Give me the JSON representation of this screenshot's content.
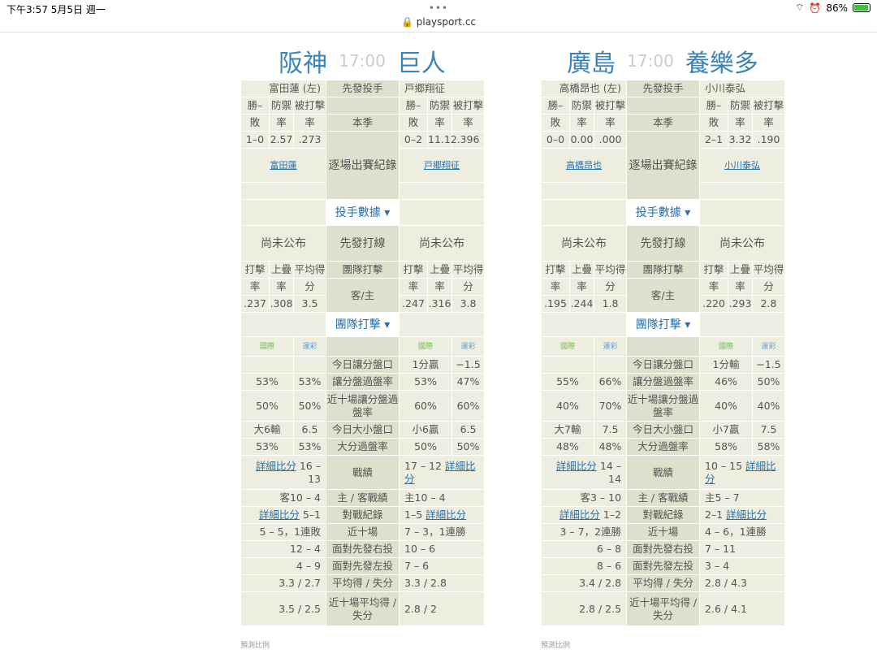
{
  "status": {
    "time": "下午3:57   5月5日 週一",
    "battery": "86%"
  },
  "url": "playsport.cc",
  "games": [
    {
      "away": "阪神",
      "time": "17:00",
      "home": "巨人",
      "pitching": {
        "away_pitcher": "富田蓮 (左)",
        "label": "先發投手",
        "home_pitcher": "戸郷翔征",
        "h1": [
          "勝–",
          "防禦",
          "被打擊"
        ],
        "h2": [
          "敗",
          "率",
          "率"
        ],
        "season_label": "本季",
        "away_stats": [
          "1–0",
          "2.57",
          ".273"
        ],
        "home_stats": [
          "0–2",
          "11.12",
          ".396"
        ],
        "log_label": "逐場出賽紀錄",
        "away_link": "富田蓮",
        "home_link": "戸郷翔征",
        "dropdown": "投手數據 ▾"
      },
      "batting": {
        "away_lineup": "尚未公布",
        "label": "先發打線",
        "home_lineup": "尚未公布",
        "h1": [
          "打擊",
          "上疊",
          "平均得"
        ],
        "h2": [
          "率",
          "率",
          "分"
        ],
        "team_label": "團隊打擊",
        "ha_label": "客/主",
        "away_stats": [
          ".237",
          ".308",
          "3.5"
        ],
        "home_stats": [
          ".247",
          ".316",
          "3.8"
        ],
        "dropdown": "團隊打擊 ▾"
      },
      "odds": {
        "src_a": "國際",
        "src_b": "運彩",
        "labels": [
          "今日讓分盤口",
          "讓分盤過盤率",
          "近十場讓分盤過盤率",
          "今日大小盤口",
          "大分過盤率"
        ],
        "away_rows": [
          [
            "",
            ""
          ],
          [
            "53%",
            "53%"
          ],
          [
            "50%",
            "50%"
          ],
          [
            "大6輸",
            "6.5"
          ],
          [
            "53%",
            "53%"
          ]
        ],
        "home_rows": [
          [
            "1分贏",
            "−1.5"
          ],
          [
            "53%",
            "47%"
          ],
          [
            "60%",
            "60%"
          ],
          [
            "小6贏",
            "6.5"
          ],
          [
            "50%",
            "50%"
          ]
        ]
      },
      "record": {
        "detail": "詳細比分",
        "rows": [
          {
            "label": "戰績",
            "away": "16 – 13",
            "home": "17 – 12",
            "link": true
          },
          {
            "label": "主 / 客戰績",
            "away": "客10 – 4",
            "home": "主10 – 4"
          },
          {
            "label": "對戰紀錄",
            "away": "5–1",
            "home": "1–5",
            "link": true
          },
          {
            "label": "近十場",
            "away": "5 – 5，1連敗",
            "home": "7 – 3，1連勝"
          },
          {
            "label": "面對先發右投",
            "away": "12 – 4",
            "home": "10 – 6"
          },
          {
            "label": "面對先發左投",
            "away": "4 – 9",
            "home": "7 – 6"
          },
          {
            "label": "平均得 / 失分",
            "away": "3.3 / 2.7",
            "home": "3.3 / 2.8"
          },
          {
            "label": "近十場平均得 / 失分",
            "away": "3.5 / 2.5",
            "home": "2.8 / 2"
          }
        ]
      },
      "footer": "預測比例"
    },
    {
      "away": "廣島",
      "time": "17:00",
      "home": "養樂多",
      "pitching": {
        "away_pitcher": "高橋昂也 (左)",
        "label": "先發投手",
        "home_pitcher": "小川泰弘",
        "h1": [
          "勝–",
          "防禦",
          "被打擊"
        ],
        "h2": [
          "敗",
          "率",
          "率"
        ],
        "season_label": "本季",
        "away_stats": [
          "0–0",
          "0.00",
          ".000"
        ],
        "home_stats": [
          "2–1",
          "3.32",
          ".190"
        ],
        "log_label": "逐場出賽紀錄",
        "away_link": "高橋昂也",
        "home_link": "小川泰弘",
        "dropdown": "投手數據 ▾"
      },
      "batting": {
        "away_lineup": "尚未公布",
        "label": "先發打線",
        "home_lineup": "尚未公布",
        "h1": [
          "打擊",
          "上疊",
          "平均得"
        ],
        "h2": [
          "率",
          "率",
          "分"
        ],
        "team_label": "團隊打擊",
        "ha_label": "客/主",
        "away_stats": [
          ".195",
          ".244",
          "1.8"
        ],
        "home_stats": [
          ".220",
          ".293",
          "2.8"
        ],
        "dropdown": "團隊打擊 ▾"
      },
      "odds": {
        "src_a": "國際",
        "src_b": "運彩",
        "labels": [
          "今日讓分盤口",
          "讓分盤過盤率",
          "近十場讓分盤過盤率",
          "今日大小盤口",
          "大分過盤率"
        ],
        "away_rows": [
          [
            "",
            ""
          ],
          [
            "55%",
            "66%"
          ],
          [
            "40%",
            "70%"
          ],
          [
            "大7輸",
            "7.5"
          ],
          [
            "48%",
            "48%"
          ]
        ],
        "home_rows": [
          [
            "1分輸",
            "−1.5"
          ],
          [
            "46%",
            "50%"
          ],
          [
            "40%",
            "40%"
          ],
          [
            "小7贏",
            "7.5"
          ],
          [
            "58%",
            "58%"
          ]
        ]
      },
      "record": {
        "detail": "詳細比分",
        "rows": [
          {
            "label": "戰績",
            "away": "14 – 14",
            "home": "10 – 15",
            "link": true
          },
          {
            "label": "主 / 客戰績",
            "away": "客3 – 10",
            "home": "主5 – 7"
          },
          {
            "label": "對戰紀錄",
            "away": "1–2",
            "home": "2–1",
            "link": true
          },
          {
            "label": "近十場",
            "away": "3 – 7，2連勝",
            "home": "4 – 6，1連勝"
          },
          {
            "label": "面對先發右投",
            "away": "6 – 8",
            "home": "7 – 11"
          },
          {
            "label": "面對先發左投",
            "away": "8 – 6",
            "home": "3 – 4"
          },
          {
            "label": "平均得 / 失分",
            "away": "3.4 / 2.8",
            "home": "2.8 / 4.3"
          },
          {
            "label": "近十場平均得 / 失分",
            "away": "2.8 / 2.5",
            "home": "2.6 / 4.1"
          }
        ]
      },
      "footer": "預測比例"
    }
  ]
}
